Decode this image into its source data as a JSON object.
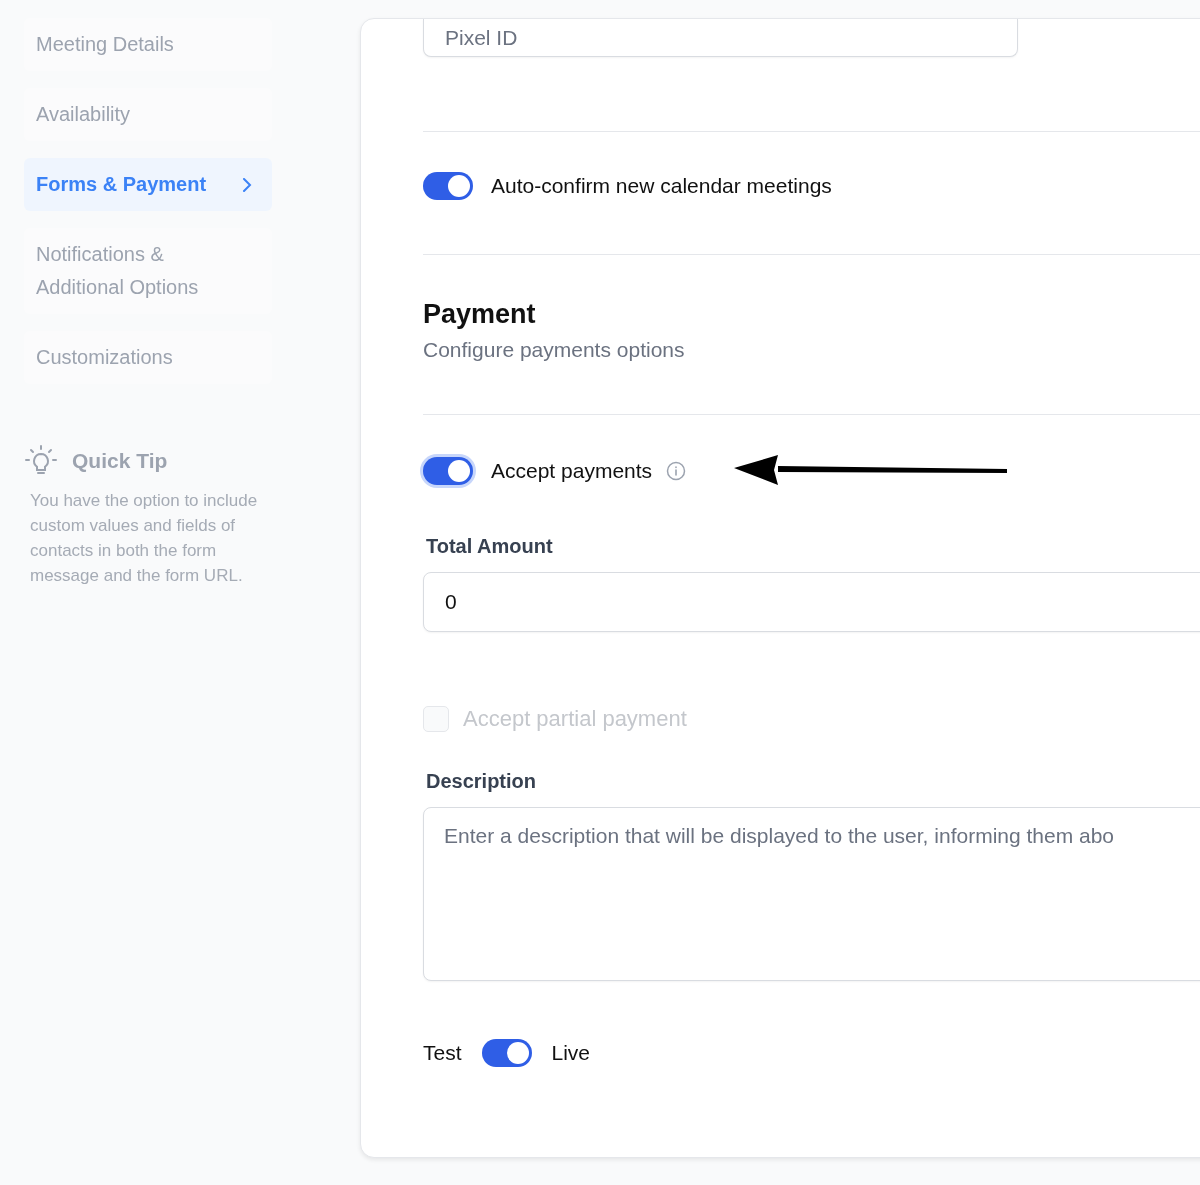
{
  "sidebar": {
    "items": [
      {
        "label": "Meeting Details",
        "selected": false
      },
      {
        "label": "Availability",
        "selected": false
      },
      {
        "label": "Forms & Payment",
        "selected": true
      },
      {
        "label": "Notifications & Additional Options",
        "selected": false
      },
      {
        "label": "Customizations",
        "selected": false
      }
    ],
    "quick_tip": {
      "title": "Quick Tip",
      "text": "You have the option to include custom values and fields of contacts in both the form message and the form URL."
    }
  },
  "pixel_id": {
    "placeholder": "Pixel ID"
  },
  "auto_confirm": {
    "label": "Auto-confirm new calendar meetings",
    "on": true
  },
  "payment": {
    "title": "Payment",
    "subtitle": "Configure payments options",
    "accept_payments": {
      "label": "Accept payments",
      "on": true,
      "focused": true
    },
    "total_amount": {
      "label": "Total Amount",
      "value": "0"
    },
    "partial_payment": {
      "label": "Accept partial payment",
      "checked": false,
      "disabled": true
    },
    "description": {
      "label": "Description",
      "placeholder": "Enter a description that will be displayed to the user, informing them abo"
    },
    "mode": {
      "left_label": "Test",
      "right_label": "Live",
      "on": true
    }
  }
}
